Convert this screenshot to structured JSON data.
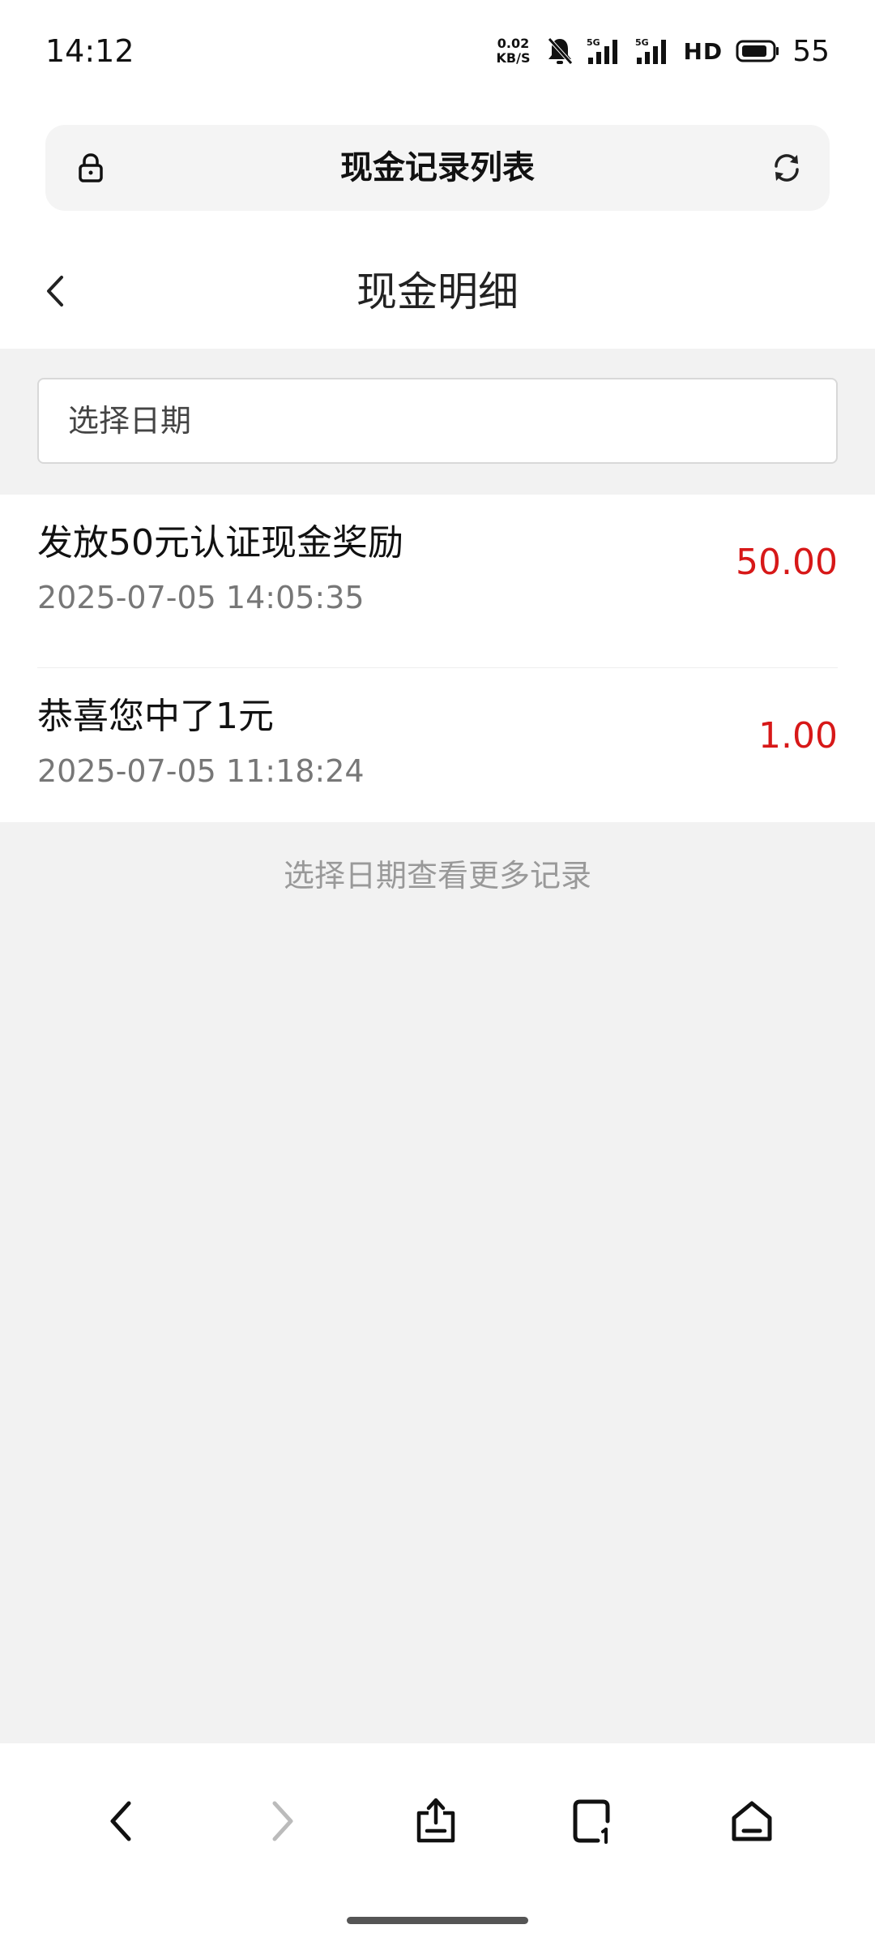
{
  "status_bar": {
    "time": "14:12",
    "net_speed_value": "0.02",
    "net_speed_unit": "KB/S",
    "signal_label": "5G",
    "hd_label": "HD",
    "battery_level": "55"
  },
  "browser": {
    "page_title": "现金记录列表"
  },
  "header": {
    "title": "现金明细"
  },
  "filter": {
    "date_placeholder": "选择日期"
  },
  "records": [
    {
      "title": "发放50元认证现金奖励",
      "time": "2025-07-05 14:05:35",
      "amount": "50.00"
    },
    {
      "title": "恭喜您中了1元",
      "time": "2025-07-05 11:18:24",
      "amount": "1.00"
    }
  ],
  "more_hint": "选择日期查看更多记录",
  "colors": {
    "amount": "#d71818",
    "background": "#f2f2f2"
  }
}
